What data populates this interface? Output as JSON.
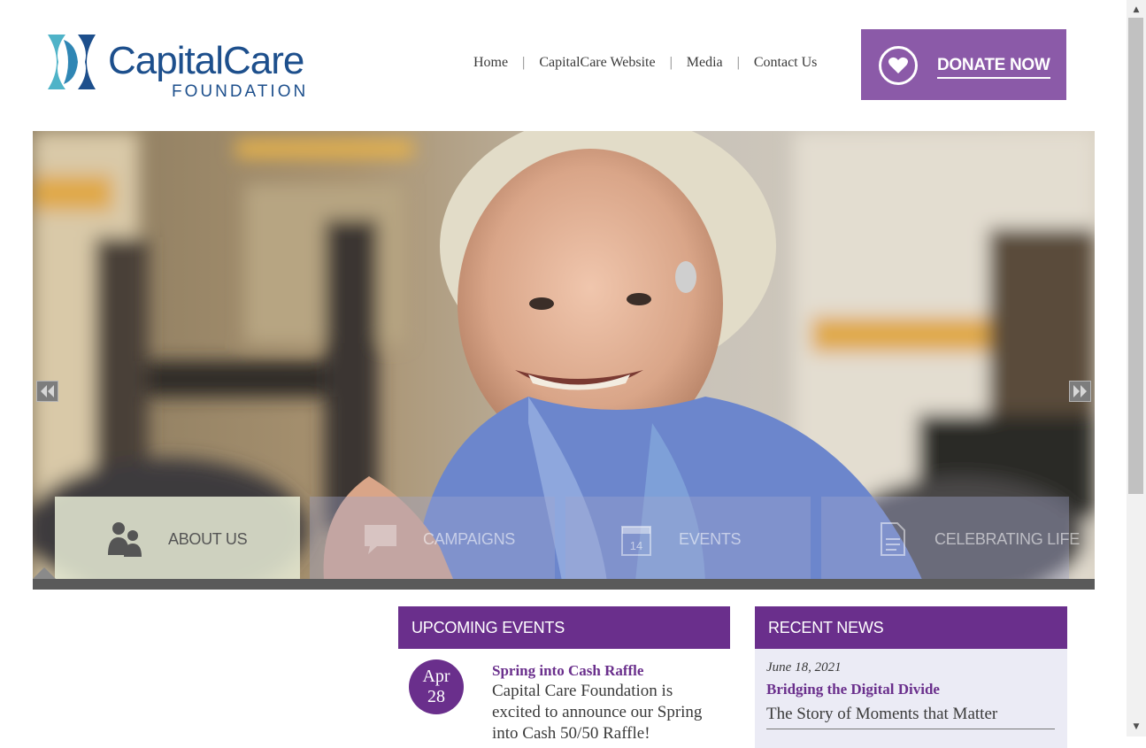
{
  "brand": {
    "name": "CapitalCare",
    "sub": "FOUNDATION",
    "colors": {
      "navy": "#1d4f8c",
      "teal": "#4fb3c8",
      "purple": "#6a2f8c",
      "donate": "#8b5aa8"
    }
  },
  "nav": {
    "items": [
      {
        "label": "Home"
      },
      {
        "label": "CapitalCare Website"
      },
      {
        "label": "Media"
      },
      {
        "label": "Contact Us"
      }
    ],
    "separator": "|"
  },
  "donate": {
    "label": "DONATE NOW",
    "icon": "heart-icon"
  },
  "hero": {
    "prev_icon": "double-chevron-left-icon",
    "next_icon": "double-chevron-right-icon",
    "tabs": [
      {
        "label": "ABOUT US",
        "icon": "people-icon",
        "active": true
      },
      {
        "label": "CAMPAIGNS",
        "icon": "speech-bubble-icon",
        "active": false
      },
      {
        "label": "EVENTS",
        "icon": "calendar-icon",
        "calendar_day": "14",
        "active": false
      },
      {
        "label": "CELEBRATING LIFE",
        "icon": "document-icon",
        "active": false
      }
    ]
  },
  "events": {
    "heading": "UPCOMING EVENTS",
    "items": [
      {
        "month": "Apr",
        "day": "28",
        "title": "Spring into Cash Raffle",
        "text": "Capital Care Foundation is excited to announce our Spring into Cash 50/50 Raffle!"
      }
    ]
  },
  "news": {
    "heading": "RECENT NEWS",
    "items": [
      {
        "date": "June 18, 2021",
        "title": "Bridging the Digital Divide",
        "subtitle": "The Story of Moments that Matter"
      }
    ]
  }
}
